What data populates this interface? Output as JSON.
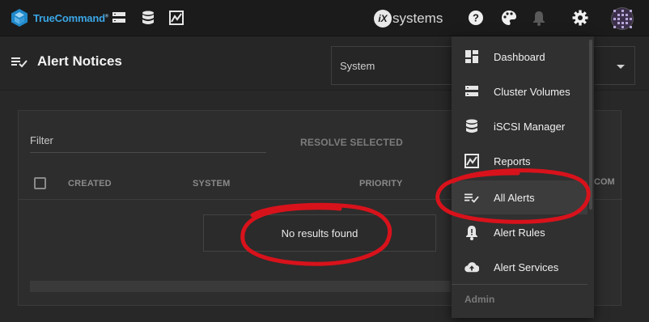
{
  "app": {
    "name": "TrueCommand",
    "trademark": "®"
  },
  "topbar": {
    "brand": {
      "mark": "iX",
      "text": "systems"
    },
    "nav_icons": [
      "servers-icon",
      "database-icon",
      "chart-icon"
    ],
    "right_icons": [
      "help-icon",
      "palette-icon",
      "bell-icon",
      "gear-icon"
    ]
  },
  "page": {
    "title": "Alert Notices",
    "system_select": {
      "value": "System"
    }
  },
  "table": {
    "filter_label": "Filter",
    "resolve_label": "RESOLVE SELECTED",
    "columns": [
      "CREATED",
      "SYSTEM",
      "PRIORITY"
    ],
    "truncated_column": "COM",
    "empty_message": "No results found"
  },
  "settings_menu": {
    "items": [
      {
        "label": "Dashboard",
        "icon": "dashboard-icon"
      },
      {
        "label": "Cluster Volumes",
        "icon": "servers-icon"
      },
      {
        "label": "iSCSI Manager",
        "icon": "database-icon"
      },
      {
        "label": "Reports",
        "icon": "chart-icon"
      },
      {
        "label": "All Alerts",
        "icon": "list-check-icon"
      },
      {
        "label": "Alert Rules",
        "icon": "alert-bell-icon"
      },
      {
        "label": "Alert Services",
        "icon": "cloud-upload-icon"
      }
    ],
    "section_label": "Admin"
  },
  "colors": {
    "accent": "#3aa6e6",
    "annotation": "#d8121b",
    "topbar": "#1b1b1b"
  }
}
